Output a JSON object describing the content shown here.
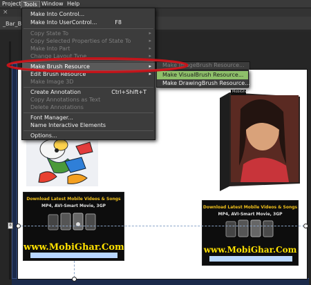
{
  "menubar": {
    "items": [
      "Project",
      "Tools",
      "Window",
      "Help"
    ]
  },
  "document": {
    "tab_close": "×",
    "tab_label": "_Bar_Ball"
  },
  "tools_menu": {
    "items": [
      {
        "label": "Make Into Control...",
        "shortcut": "",
        "enabled": true,
        "submenu": false
      },
      {
        "label": "Make Into UserControl...",
        "shortcut": "F8",
        "enabled": true,
        "submenu": false
      },
      {
        "label": "Copy State To",
        "shortcut": "",
        "enabled": false,
        "submenu": true
      },
      {
        "label": "Copy Selected Properties of State To",
        "shortcut": "",
        "enabled": false,
        "submenu": true
      },
      {
        "label": "Make Into Part",
        "shortcut": "",
        "enabled": false,
        "submenu": true
      },
      {
        "label": "Change Layout Type",
        "shortcut": "",
        "enabled": false,
        "submenu": true
      },
      {
        "label": "Make Brush Resource",
        "shortcut": "",
        "enabled": true,
        "submenu": true
      },
      {
        "label": "Edit Brush Resource",
        "shortcut": "",
        "enabled": true,
        "submenu": true
      },
      {
        "label": "Make Image 3D",
        "shortcut": "",
        "enabled": false,
        "submenu": false
      },
      {
        "label": "Create Annotation",
        "shortcut": "Ctrl+Shift+T",
        "enabled": true,
        "submenu": false
      },
      {
        "label": "Copy Annotations as Text",
        "shortcut": "",
        "enabled": false,
        "submenu": false
      },
      {
        "label": "Delete Annotations",
        "shortcut": "",
        "enabled": false,
        "submenu": false
      },
      {
        "label": "Font Manager...",
        "shortcut": "",
        "enabled": true,
        "submenu": false
      },
      {
        "label": "Name Interactive Elements",
        "shortcut": "",
        "enabled": true,
        "submenu": false
      },
      {
        "label": "Options...",
        "shortcut": "",
        "enabled": true,
        "submenu": false
      }
    ],
    "arrow": "▸"
  },
  "brush_submenu": {
    "disabled_item": "Make ImageBrush Resource...",
    "items": [
      "Make VisualBrush Resource...",
      "Make DrawingBrush Resource..."
    ]
  },
  "artboard": {
    "ruler_marker": "8",
    "banner": {
      "title": "Download Latest Mobile Videos & Songs",
      "subtitle": "MP4, AVI-Smart Movie, 3GP",
      "url": "www.MobiGhar.Com"
    },
    "video_caption": "MobiGhar"
  },
  "colors": {
    "highlight_green": "#8ec06a",
    "annotation_red": "#c3141a",
    "banner_gold": "#f2c21c",
    "url_yellow": "#ffe100"
  }
}
